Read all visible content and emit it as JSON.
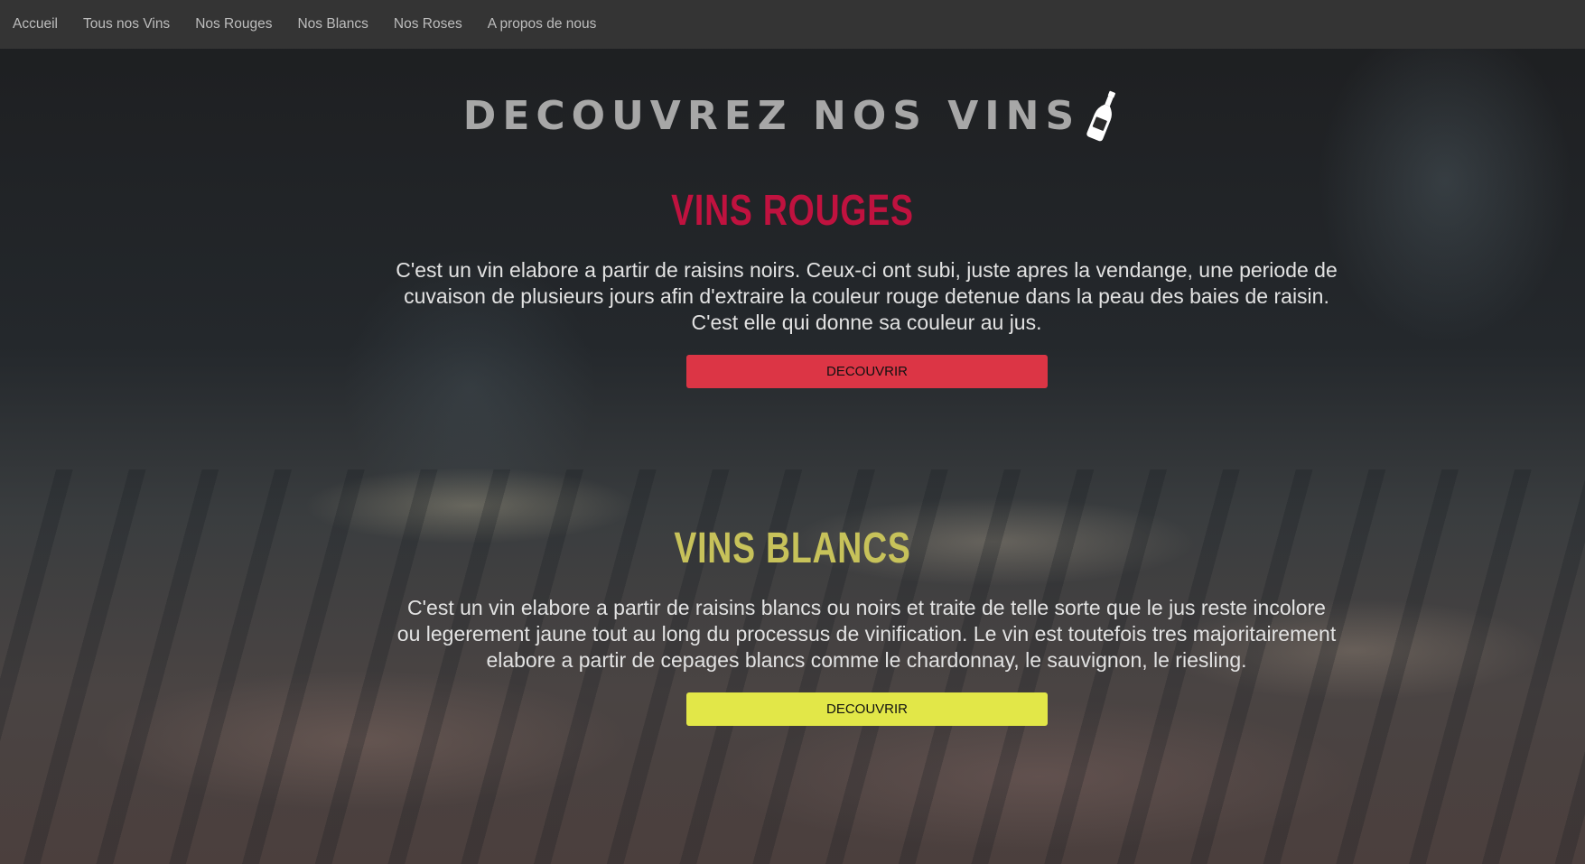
{
  "nav": {
    "items": [
      {
        "label": "Accueil"
      },
      {
        "label": "Tous nos Vins"
      },
      {
        "label": "Nos Rouges"
      },
      {
        "label": "Nos Blancs"
      },
      {
        "label": "Nos Roses"
      },
      {
        "label": "A propos de nous"
      }
    ]
  },
  "hero": {
    "title": "DECOUVREZ NOS VINS",
    "icon": "wine-bottle-icon"
  },
  "sections": {
    "rouges": {
      "title": "VINS ROUGES",
      "text": "C'est un vin elabore a partir de raisins noirs. Ceux-ci ont subi, juste apres la vendange, une periode de cuvaison de plusieurs jours afin d'extraire la couleur rouge detenue dans la peau des baies de raisin. C'est elle qui donne sa couleur au jus.",
      "button_label": "DECOUVRIR",
      "title_color": "#c0123f",
      "button_color": "#dc3545"
    },
    "blancs": {
      "title": "VINS BLANCS",
      "text": "C'est un vin elabore a partir de raisins blancs ou noirs et traite de telle sorte que le jus reste incolore ou legerement jaune tout au long du processus de vinification. Le vin est toutefois tres majoritairement elabore a partir de cepages blancs comme le chardonnay, le sauvignon, le riesling.",
      "button_label": "DECOUVRIR",
      "title_color": "#c7c25a",
      "button_color": "#e2e748"
    }
  },
  "colors": {
    "navbar_bg": "#343434",
    "nav_text": "#bdbdbd",
    "hero_text": "#a7a7a7"
  }
}
